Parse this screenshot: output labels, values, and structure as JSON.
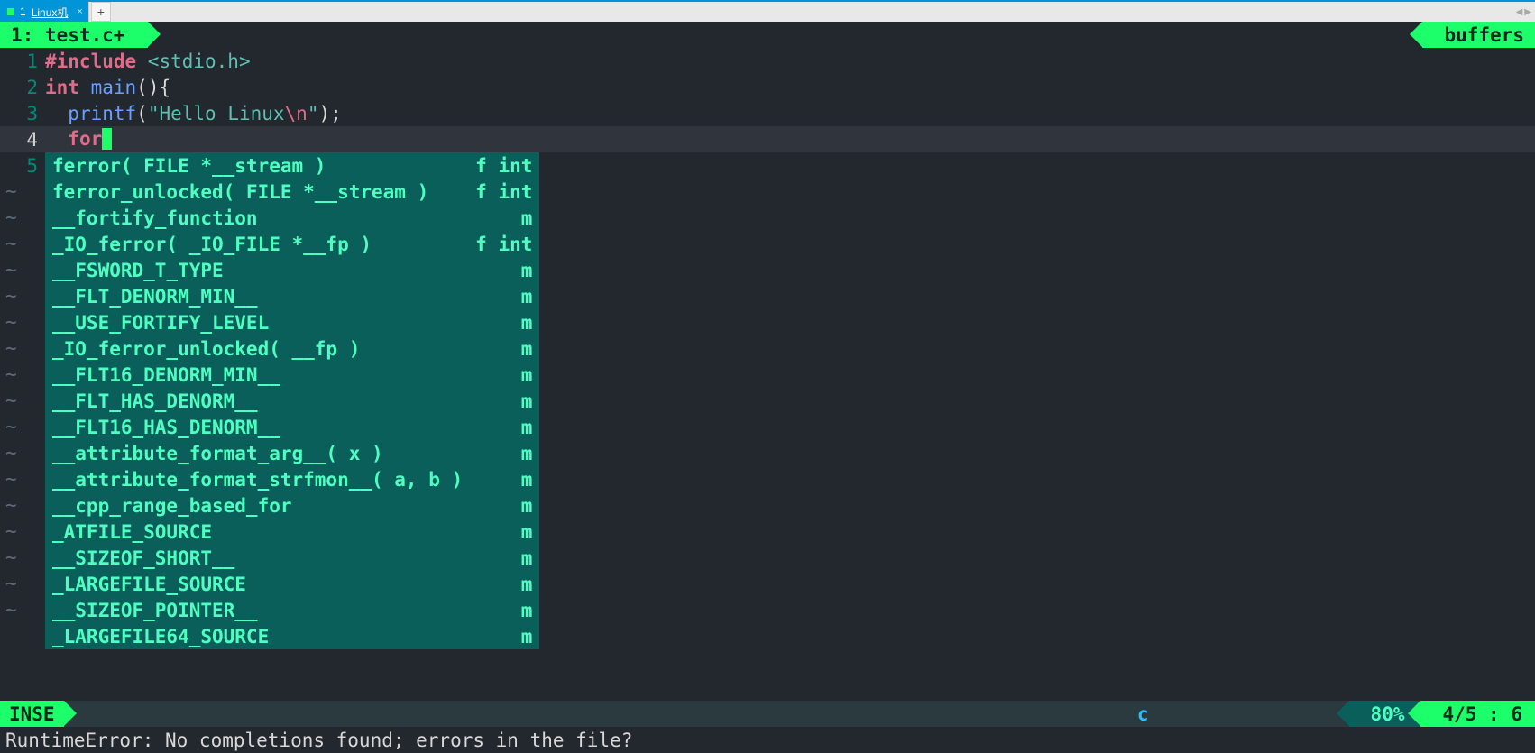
{
  "window": {
    "tab_index": "1",
    "tab_title": "Linux机",
    "add_label": "+"
  },
  "bufferline": {
    "left": "1: test.c+",
    "right": "buffers"
  },
  "code": {
    "lines": [
      {
        "n": "1",
        "tokens": [
          "#include ",
          "<stdio.h>"
        ]
      },
      {
        "n": "2",
        "tokens": [
          "int",
          " ",
          "main",
          "(){"
        ]
      },
      {
        "n": "3",
        "tokens": [
          "  ",
          "printf",
          "(",
          "\"Hello Linux",
          "\\n",
          "\"",
          ");"
        ]
      },
      {
        "n": "4",
        "tokens": [
          "  ",
          "for"
        ]
      },
      {
        "n": "5",
        "tokens": [
          "}"
        ]
      }
    ]
  },
  "popup": [
    {
      "label": "ferror( FILE *__stream )",
      "kind": "f int"
    },
    {
      "label": "ferror_unlocked( FILE *__stream )",
      "kind": "f int"
    },
    {
      "label": "__fortify_function",
      "kind": "m"
    },
    {
      "label": "_IO_ferror( _IO_FILE *__fp )",
      "kind": "f int"
    },
    {
      "label": "__FSWORD_T_TYPE",
      "kind": "m"
    },
    {
      "label": "__FLT_DENORM_MIN__",
      "kind": "m"
    },
    {
      "label": "__USE_FORTIFY_LEVEL",
      "kind": "m"
    },
    {
      "label": "_IO_ferror_unlocked( __fp )",
      "kind": "m"
    },
    {
      "label": "__FLT16_DENORM_MIN__",
      "kind": "m"
    },
    {
      "label": "__FLT_HAS_DENORM__",
      "kind": "m"
    },
    {
      "label": "__FLT16_HAS_DENORM__",
      "kind": "m"
    },
    {
      "label": "__attribute_format_arg__( x )",
      "kind": "m"
    },
    {
      "label": "__attribute_format_strfmon__( a, b )",
      "kind": "m"
    },
    {
      "label": "__cpp_range_based_for",
      "kind": "m"
    },
    {
      "label": "_ATFILE_SOURCE",
      "kind": "m"
    },
    {
      "label": "__SIZEOF_SHORT__",
      "kind": "m"
    },
    {
      "label": "_LARGEFILE_SOURCE",
      "kind": "m"
    },
    {
      "label": "__SIZEOF_POINTER__",
      "kind": "m"
    },
    {
      "label": "_LARGEFILE64_SOURCE",
      "kind": "m"
    }
  ],
  "status": {
    "mode": "INSE",
    "filetype": "c",
    "percent": "80%",
    "position": "4/5 :  6"
  },
  "message": "RuntimeError: No completions found; errors in the file?",
  "tildes": 17
}
